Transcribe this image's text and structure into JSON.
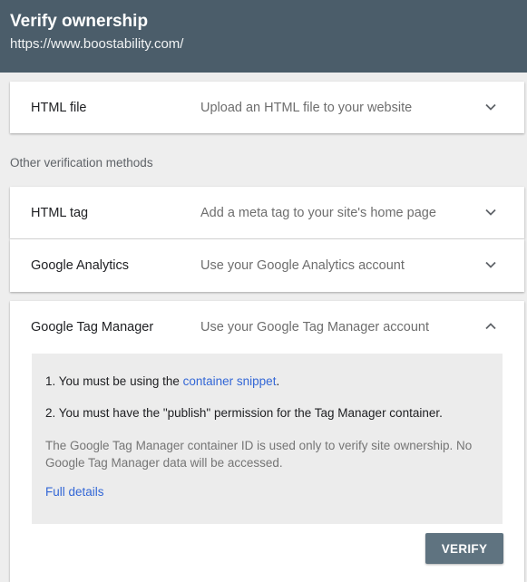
{
  "header": {
    "title": "Verify ownership",
    "url": "https://www.boostability.com/"
  },
  "primary_method": {
    "name": "HTML file",
    "description": "Upload an HTML file to your website"
  },
  "other_methods_label": "Other verification methods",
  "methods": [
    {
      "name": "HTML tag",
      "description": "Add a meta tag to your site's home page",
      "expanded": false
    },
    {
      "name": "Google Analytics",
      "description": "Use your Google Analytics account",
      "expanded": false
    },
    {
      "name": "Google Tag Manager",
      "description": "Use your Google Tag Manager account",
      "expanded": true
    }
  ],
  "tag_manager_details": {
    "step1_prefix": "1. You must be using the ",
    "step1_link": "container snippet",
    "step1_suffix": ".",
    "step2": "2. You must have the \"publish\" permission for the Tag Manager container.",
    "note": "The Google Tag Manager container ID is used only to verify site ownership. No Google Tag Manager data will be accessed.",
    "full_details_link": "Full details",
    "verify_label": "VERIFY"
  },
  "colors": {
    "header_bg": "#4b5d6a",
    "link": "#3367d6",
    "button_bg": "#5f7380",
    "panel_bg": "#ececec"
  }
}
